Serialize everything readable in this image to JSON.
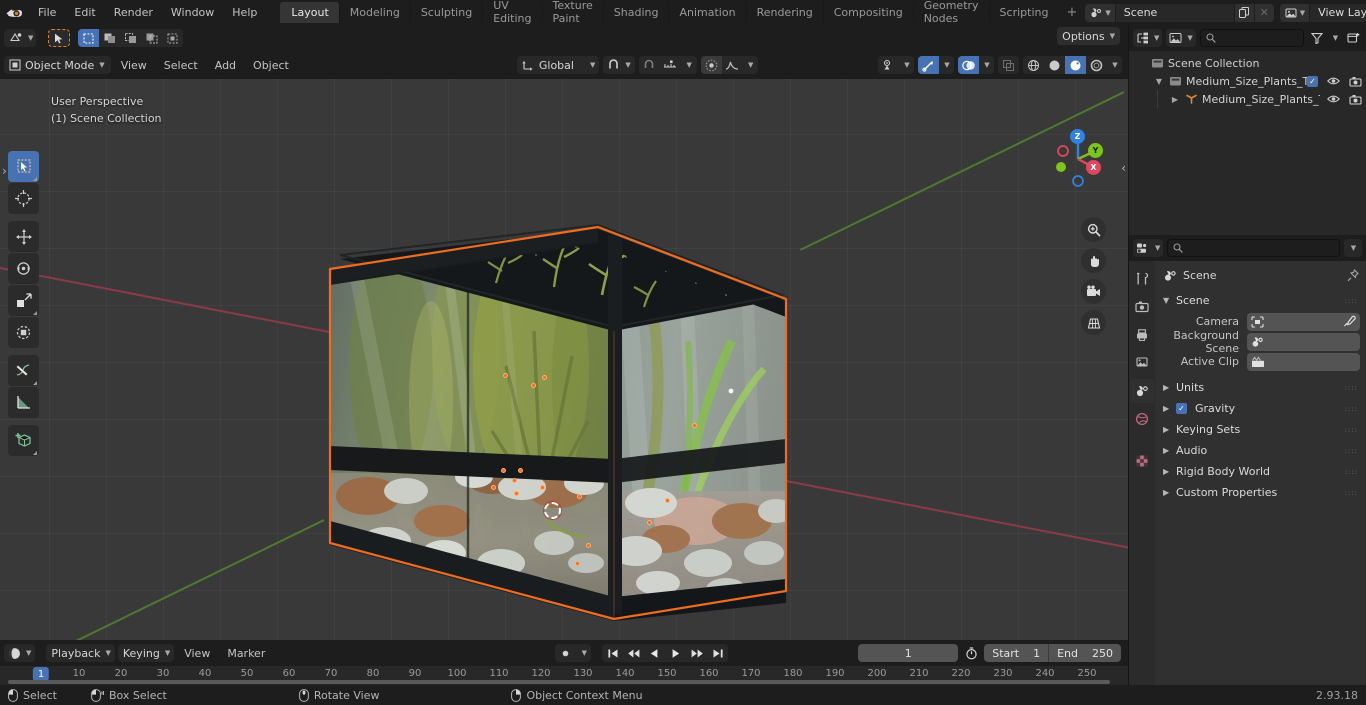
{
  "app": {
    "name": "Blender",
    "version": "2.93.18"
  },
  "topbar": {
    "menus": [
      "File",
      "Edit",
      "Render",
      "Window",
      "Help"
    ],
    "tabs": [
      {
        "label": "Layout",
        "active": true
      },
      {
        "label": "Modeling",
        "active": false
      },
      {
        "label": "Sculpting",
        "active": false
      },
      {
        "label": "UV Editing",
        "active": false
      },
      {
        "label": "Texture Paint",
        "active": false
      },
      {
        "label": "Shading",
        "active": false
      },
      {
        "label": "Animation",
        "active": false
      },
      {
        "label": "Rendering",
        "active": false
      },
      {
        "label": "Compositing",
        "active": false
      },
      {
        "label": "Geometry Nodes",
        "active": false
      },
      {
        "label": "Scripting",
        "active": false
      }
    ],
    "add_tab": "+",
    "scene": {
      "name": "Scene",
      "icon": "scene-icon",
      "new_icon": "duplicate-icon",
      "unlink_icon": "x-icon"
    },
    "view_layer": {
      "name": "View Layer",
      "icon": "view-layer-icon",
      "new_icon": "duplicate-icon",
      "unlink_icon": "x-icon"
    }
  },
  "viewport_header": {
    "editor_type": "editor-type-3dview-icon",
    "mode": "Object Mode",
    "mode_icon": "object-mode-icon",
    "menus": [
      "View",
      "Select",
      "Add",
      "Object"
    ],
    "select_modes": [
      "tweak-select-icon",
      "box-select-icon",
      "circle-select-icon",
      "lasso-select-icon",
      "extend-select-icon"
    ],
    "transform_orientation": "Global",
    "transform_orientation_icon": "orientation-icon",
    "snap_icon": "magnet-icon",
    "snap_target_icon": "snap-increment-icon",
    "proportional_icon": "proportional-edit-icon",
    "falloff_icon": "smooth-falloff-icon",
    "options_label": "Options",
    "visibility_icon": "object-types-visibility-icon",
    "gizmo_icon": "gizmo-icon",
    "overlays_icon": "overlays-icon",
    "xray_icon": "xray-icon",
    "shading": [
      {
        "name": "wireframe-shading-icon",
        "active": false
      },
      {
        "name": "solid-shading-icon",
        "active": false
      },
      {
        "name": "material-preview-shading-icon",
        "active": true
      },
      {
        "name": "rendered-shading-icon",
        "active": false
      }
    ]
  },
  "viewport": {
    "overlay_line1": "User Perspective",
    "overlay_line2": "(1) Scene Collection",
    "tools": [
      {
        "name": "tweak-tool",
        "active": true
      },
      {
        "name": "cursor-tool",
        "active": false
      },
      {
        "name": "move-tool",
        "active": false
      },
      {
        "name": "rotate-tool",
        "active": false
      },
      {
        "name": "scale-tool",
        "active": false
      },
      {
        "name": "transform-tool",
        "active": false
      },
      {
        "name": "annotate-tool",
        "active": false
      },
      {
        "name": "measure-tool",
        "active": false
      },
      {
        "name": "add-cube-tool",
        "active": false
      }
    ],
    "gizmo_axes": [
      {
        "label": "Z",
        "color": "#2f83e3"
      },
      {
        "label": "Y",
        "color": "#7dc41c"
      },
      {
        "label": "X",
        "color": "#e04860"
      }
    ],
    "nav_buttons": [
      "zoom-icon",
      "pan-hand-icon",
      "camera-view-icon",
      "toggle-ortho-icon"
    ],
    "selection_color": "#f06c1e",
    "object": "Medium_Size_Plants_Terrarium"
  },
  "outliner": {
    "display_mode_icon": "outliner-display-mode-icon",
    "filter_icon": "filter-icon",
    "new_collection_icon": "new-collection-icon",
    "search_placeholder": "",
    "rows": [
      {
        "name": "Scene Collection",
        "icon": "collection-icon",
        "depth": 0,
        "expandable": false,
        "checkbox": false,
        "eye": false,
        "camera": false
      },
      {
        "name": "Medium_Size_Plants_Terrariur",
        "icon": "collection-icon",
        "depth": 1,
        "expandable": true,
        "expanded": true,
        "checkbox": true,
        "eye": true,
        "camera": true
      },
      {
        "name": "Medium_Size_Plants_Terr",
        "icon": "mesh-object-icon",
        "depth": 2,
        "expandable": true,
        "expanded": false,
        "checkbox": false,
        "eye": true,
        "camera": true
      }
    ]
  },
  "properties": {
    "editor_icon": "properties-editor-icon",
    "search_placeholder": "",
    "tabs": [
      {
        "name": "tool-tab",
        "active": false
      },
      {
        "name": "render-tab",
        "active": false
      },
      {
        "name": "output-tab",
        "active": false
      },
      {
        "name": "view-layer-tab",
        "active": false
      },
      {
        "name": "scene-tab",
        "active": true
      },
      {
        "name": "world-tab",
        "active": false
      },
      {
        "name": "texture-tab",
        "active": false
      }
    ],
    "breadcrumb": "Scene",
    "breadcrumb_icon": "scene-icon",
    "pin_icon": "pin-icon",
    "panels": [
      {
        "label": "Scene",
        "expanded": true
      },
      {
        "label": "Units",
        "expanded": false
      },
      {
        "label": "Gravity",
        "expanded": false,
        "checkbox": true
      },
      {
        "label": "Keying Sets",
        "expanded": false
      },
      {
        "label": "Audio",
        "expanded": false
      },
      {
        "label": "Rigid Body World",
        "expanded": false
      },
      {
        "label": "Custom Properties",
        "expanded": false
      }
    ],
    "scene_fields": [
      {
        "label": "Camera",
        "value": "",
        "icon": "camera-data-icon",
        "eyedropper": true
      },
      {
        "label": "Background Scene",
        "value": "",
        "icon": "scene-icon",
        "eyedropper": false
      },
      {
        "label": "Active Clip",
        "value": "",
        "icon": "clip-icon",
        "eyedropper": false
      }
    ]
  },
  "timeline": {
    "editor_icon": "timeline-editor-icon",
    "menus": [
      "Playback",
      "Keying",
      "View",
      "Marker"
    ],
    "record_icon": "auto-keying-icon",
    "transport": [
      "jump-to-start-icon",
      "prev-keyframe-icon",
      "play-reverse-icon",
      "play-icon",
      "next-keyframe-icon",
      "jump-to-end-icon"
    ],
    "current_frame": "1",
    "frame_icon": "use-preview-range-icon",
    "start_label": "Start",
    "start_value": "1",
    "end_label": "End",
    "end_value": "250",
    "ticks": [
      10,
      20,
      30,
      40,
      50,
      60,
      70,
      80,
      90,
      100,
      110,
      120,
      130,
      140,
      150,
      160,
      170,
      180,
      190,
      200,
      210,
      220,
      230,
      240,
      250
    ],
    "playhead_label": "1"
  },
  "statusbar": {
    "items": [
      {
        "icon": "mouse-left-icon",
        "label": "Select"
      },
      {
        "icon": "mouse-left-drag-icon",
        "label": "Box Select"
      },
      {
        "icon": "mouse-middle-icon",
        "label": "Rotate View"
      },
      {
        "icon": "mouse-right-icon",
        "label": "Object Context Menu"
      }
    ],
    "version": "2.93.18"
  }
}
